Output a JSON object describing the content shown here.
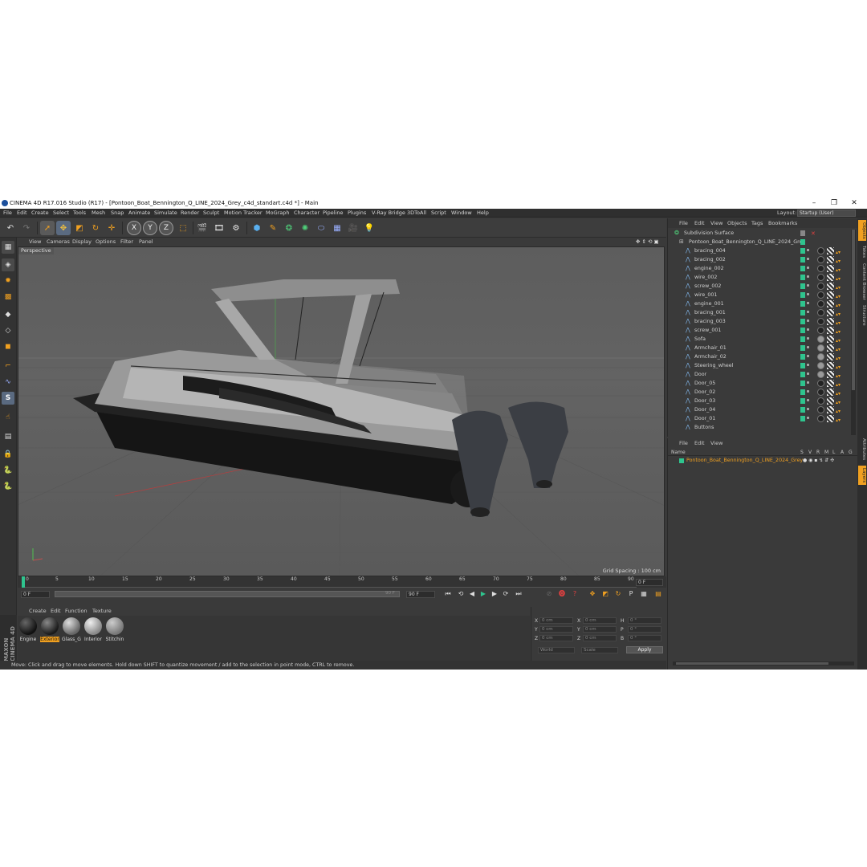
{
  "window": {
    "title": "CINEMA 4D R17.016 Studio (R17) - [Pontoon_Boat_Bennington_Q_LINE_2024_Grey_c4d_standart.c4d *] - Main",
    "minimize": "–",
    "maximize": "❐",
    "close": "✕"
  },
  "menu": [
    "File",
    "Edit",
    "Create",
    "Select",
    "Tools",
    "Mesh",
    "Snap",
    "Animate",
    "Simulate",
    "Render",
    "Sculpt",
    "Motion Tracker",
    "MoGraph",
    "Character",
    "Pipeline",
    "Plugins",
    "V-Ray Bridge",
    "3DToAll",
    "Script",
    "Window",
    "Help"
  ],
  "layout": {
    "label": "Layout:",
    "value": "Startup (User)"
  },
  "toolbar_axes": [
    "X",
    "Y",
    "Z"
  ],
  "viewport": {
    "menu": [
      "View",
      "Cameras",
      "Display",
      "Options",
      "Filter",
      "Panel"
    ],
    "label": "Perspective",
    "grid_spacing": "Grid Spacing : 100 cm"
  },
  "timeline": {
    "ticks": [
      "0",
      "5",
      "10",
      "15",
      "20",
      "25",
      "30",
      "35",
      "40",
      "45",
      "50",
      "55",
      "60",
      "65",
      "70",
      "75",
      "80",
      "85",
      "90"
    ],
    "current_frame": "0 F",
    "start": "0 F",
    "end_slider": "90 F",
    "end": "90 F"
  },
  "materials": {
    "menu": [
      "Create",
      "Edit",
      "Function",
      "Texture"
    ],
    "items": [
      {
        "name": "Engine",
        "color": "#2a2a2a"
      },
      {
        "name": "Exterior",
        "color": "#3a3a3a",
        "selected": true
      },
      {
        "name": "Glass_G",
        "color": "#8a8a8a"
      },
      {
        "name": "Interior",
        "color": "#b5b5b5"
      },
      {
        "name": "Stitchin",
        "color": "#9a9a9a"
      }
    ]
  },
  "coords": {
    "rows": [
      {
        "a": "X",
        "av": "0 cm",
        "b": "X",
        "bv": "0 cm",
        "c": "H",
        "cv": "0 °"
      },
      {
        "a": "Y",
        "av": "0 cm",
        "b": "Y",
        "bv": "0 cm",
        "c": "P",
        "cv": "0 °"
      },
      {
        "a": "Z",
        "av": "0 cm",
        "b": "Z",
        "bv": "0 cm",
        "c": "B",
        "cv": "0 °"
      }
    ],
    "mode1": "World",
    "mode2": "Scale",
    "apply": "Apply"
  },
  "status": "Move: Click and drag to move elements. Hold down SHIFT to quantize movement / add to the selection in point mode, CTRL to remove.",
  "object_manager": {
    "menu": [
      "File",
      "Edit",
      "View",
      "Objects",
      "Tags",
      "Bookmarks"
    ],
    "root": "Subdivision Surface",
    "group": "Pontoon_Boat_Bennington_Q_LINE_2024_Grey",
    "objects": [
      "bracing_004",
      "bracing_002",
      "engine_002",
      "wire_002",
      "screw_002",
      "wire_001",
      "engine_001",
      "bracing_001",
      "bracing_003",
      "screw_001",
      "Sofa",
      "Armchair_01",
      "Armchair_02",
      "Steering_wheel",
      "Door",
      "Door_05",
      "Door_02",
      "Door_03",
      "Door_04",
      "Door_01",
      "Buttons"
    ]
  },
  "layer_manager": {
    "menu": [
      "File",
      "Edit",
      "View"
    ],
    "header_name": "Name",
    "header_cols": [
      "S",
      "V",
      "R",
      "M",
      "L",
      "A",
      "G"
    ],
    "layer": "Pontoon_Boat_Bennington_Q_LINE_2024_Grey"
  },
  "right_tabs": [
    "Objects",
    "Takes",
    "Content Browser",
    "Structure",
    "Attributes",
    "Layers"
  ],
  "brand": "MAXON CINEMA 4D"
}
